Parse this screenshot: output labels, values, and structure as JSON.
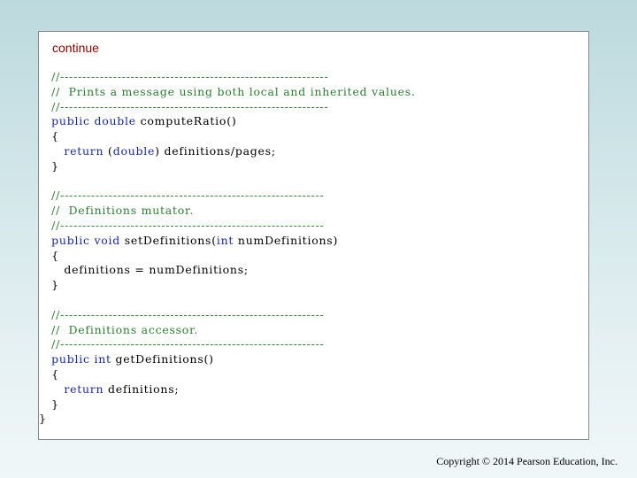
{
  "slide": {
    "continue_label": "continue",
    "copyright": "Copyright © 2014 Pearson Education, Inc."
  },
  "code_lines": [
    [
      {
        "text": "   //-------------------------------------------------------------",
        "kind": "comment"
      }
    ],
    [
      {
        "text": "   //  Prints a message using both local and inherited values.",
        "kind": "comment"
      }
    ],
    [
      {
        "text": "   //-------------------------------------------------------------",
        "kind": "comment"
      }
    ],
    [
      {
        "text": "   public double ",
        "kind": "keyword"
      },
      {
        "text": "computeRatio()",
        "kind": "plain"
      }
    ],
    [
      {
        "text": "   {",
        "kind": "plain"
      }
    ],
    [
      {
        "text": "      return ",
        "kind": "keyword"
      },
      {
        "text": "(",
        "kind": "plain"
      },
      {
        "text": "double",
        "kind": "keyword"
      },
      {
        "text": ") definitions/pages;",
        "kind": "plain"
      }
    ],
    [
      {
        "text": "   }",
        "kind": "plain"
      }
    ],
    [
      {
        "text": "",
        "kind": "plain"
      }
    ],
    [
      {
        "text": "   //------------------------------------------------------------",
        "kind": "comment"
      }
    ],
    [
      {
        "text": "   //  Definitions mutator.",
        "kind": "comment"
      }
    ],
    [
      {
        "text": "   //------------------------------------------------------------",
        "kind": "comment"
      }
    ],
    [
      {
        "text": "   public void ",
        "kind": "keyword"
      },
      {
        "text": "setDefinitions(",
        "kind": "plain"
      },
      {
        "text": "int ",
        "kind": "keyword"
      },
      {
        "text": "numDefinitions)",
        "kind": "plain"
      }
    ],
    [
      {
        "text": "   {",
        "kind": "plain"
      }
    ],
    [
      {
        "text": "      definitions = numDefinitions;",
        "kind": "plain"
      }
    ],
    [
      {
        "text": "   }",
        "kind": "plain"
      }
    ],
    [
      {
        "text": "",
        "kind": "plain"
      }
    ],
    [
      {
        "text": "   //------------------------------------------------------------",
        "kind": "comment"
      }
    ],
    [
      {
        "text": "   //  Definitions accessor.",
        "kind": "comment"
      }
    ],
    [
      {
        "text": "   //------------------------------------------------------------",
        "kind": "comment"
      }
    ],
    [
      {
        "text": "   public int ",
        "kind": "keyword"
      },
      {
        "text": "getDefinitions()",
        "kind": "plain"
      }
    ],
    [
      {
        "text": "   {",
        "kind": "plain"
      }
    ],
    [
      {
        "text": "      return ",
        "kind": "keyword"
      },
      {
        "text": "definitions;",
        "kind": "plain"
      }
    ],
    [
      {
        "text": "   }",
        "kind": "plain"
      }
    ],
    [
      {
        "text": "}",
        "kind": "plain"
      }
    ]
  ]
}
